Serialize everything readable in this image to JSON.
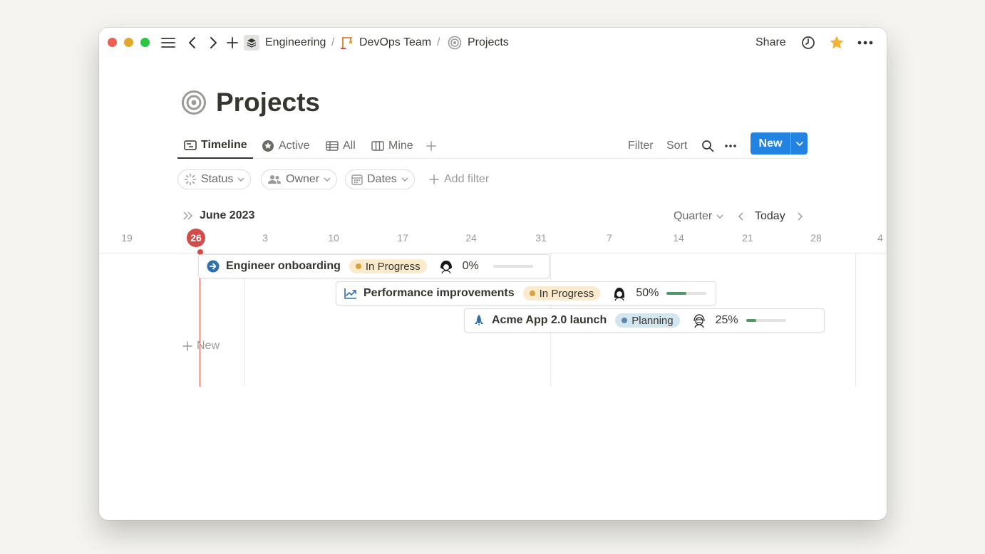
{
  "breadcrumb": {
    "items": [
      {
        "label": "Engineering"
      },
      {
        "label": "DevOps Team"
      },
      {
        "label": "Projects"
      }
    ],
    "separator": "/"
  },
  "topbar": {
    "share_label": "Share"
  },
  "page": {
    "title": "Projects",
    "icon": "target-icon"
  },
  "views": {
    "tabs": [
      {
        "label": "Timeline",
        "icon": "timeline-icon",
        "active": true
      },
      {
        "label": "Active",
        "icon": "star-circle-icon",
        "active": false
      },
      {
        "label": "All",
        "icon": "table-icon",
        "active": false
      },
      {
        "label": "Mine",
        "icon": "board-icon",
        "active": false
      }
    ],
    "filter_label": "Filter",
    "sort_label": "Sort",
    "new_label": "New"
  },
  "filters": {
    "pills": [
      {
        "label": "Status",
        "icon": "status-icon"
      },
      {
        "label": "Owner",
        "icon": "people-icon"
      },
      {
        "label": "Dates",
        "icon": "calendar-icon"
      }
    ],
    "add_filter_label": "Add filter"
  },
  "timeline": {
    "month_label": "June 2023",
    "scale_label": "Quarter",
    "today_label": "Today",
    "today_date": "26",
    "dates": [
      "19",
      "3",
      "10",
      "17",
      "24",
      "31",
      "7",
      "14",
      "21",
      "28",
      "4"
    ],
    "new_row_label": "New"
  },
  "projects": [
    {
      "title": "Engineer onboarding",
      "icon": "arrow-circle-icon",
      "status": "In Progress",
      "status_color": "#fbeacc",
      "status_dot": "#d9a23a",
      "progress_label": "0%",
      "progress": 0
    },
    {
      "title": "Performance improvements",
      "icon": "chart-line-icon",
      "status": "In Progress",
      "status_color": "#fbeacc",
      "status_dot": "#d9a23a",
      "progress_label": "50%",
      "progress": 0.5
    },
    {
      "title": "Acme App 2.0 launch",
      "icon": "rocket-icon",
      "status": "Planning",
      "status_color": "#d3e5ef",
      "status_dot": "#5e87a6",
      "progress_label": "25%",
      "progress": 0.25
    }
  ],
  "colors": {
    "accent": "#2383e2",
    "today": "#d44c47",
    "progress": "#4f9768"
  }
}
